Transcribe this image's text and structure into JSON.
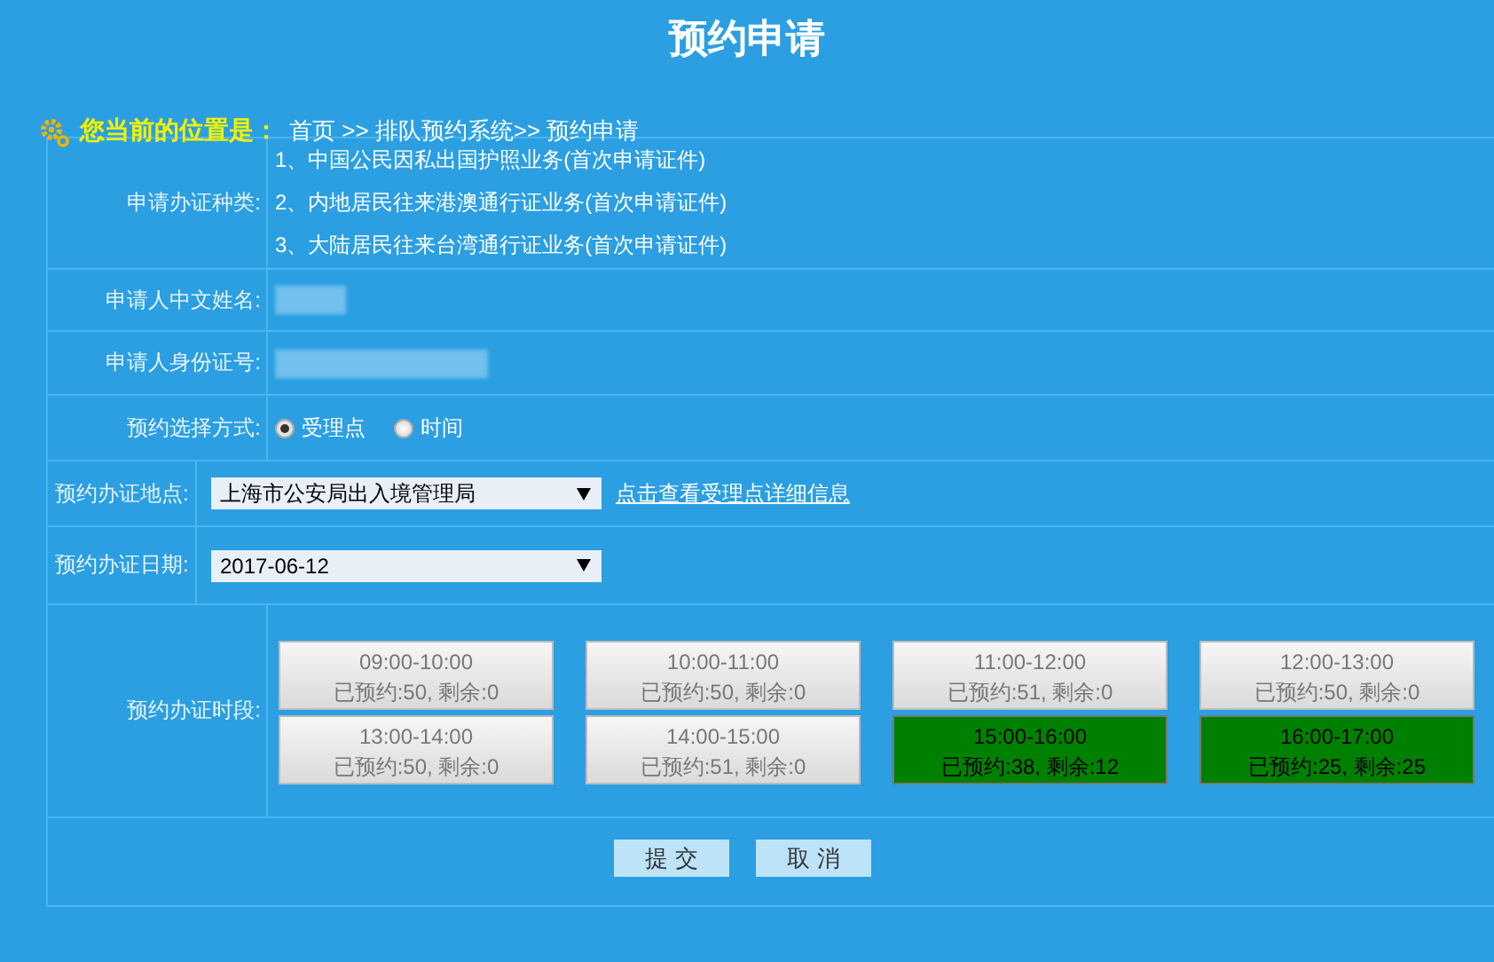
{
  "page_title": "预约申请",
  "breadcrumb": {
    "label": "您当前的位置是：",
    "path": "首页 >> 排队预约系统>> 预约申请"
  },
  "form": {
    "category": {
      "label": "申请办证种类:",
      "items": [
        "1、中国公民因私出国护照业务(首次申请证件)",
        "2、内地居民往来港澳通行证业务(首次申请证件)",
        "3、大陆居民往来台湾通行证业务(首次申请证件)"
      ]
    },
    "name": {
      "label": "申请人中文姓名:"
    },
    "id_number": {
      "label": "申请人身份证号:"
    },
    "mode": {
      "label": "预约选择方式:",
      "options": [
        {
          "label": "受理点",
          "selected": true
        },
        {
          "label": "时间",
          "selected": false
        }
      ]
    },
    "location": {
      "label": "预约办证地点:",
      "value": "上海市公安局出入境管理局",
      "link": "点击查看受理点详细信息"
    },
    "date": {
      "label": "预约办证日期:",
      "value": "2017-06-12"
    },
    "slots": {
      "label": "预约办证时段:",
      "items": [
        {
          "time": "09:00-10:00",
          "booked": "已预约:50, 剩余:0",
          "available": false
        },
        {
          "time": "10:00-11:00",
          "booked": "已预约:50, 剩余:0",
          "available": false
        },
        {
          "time": "11:00-12:00",
          "booked": "已预约:51, 剩余:0",
          "available": false
        },
        {
          "time": "12:00-13:00",
          "booked": "已预约:50, 剩余:0",
          "available": false
        },
        {
          "time": "13:00-14:00",
          "booked": "已预约:50, 剩余:0",
          "available": false
        },
        {
          "time": "14:00-15:00",
          "booked": "已预约:51, 剩余:0",
          "available": false
        },
        {
          "time": "15:00-16:00",
          "booked": "已预约:38, 剩余:12",
          "available": true
        },
        {
          "time": "16:00-17:00",
          "booked": "已预约:25, 剩余:25",
          "available": true
        }
      ]
    }
  },
  "buttons": [
    "提 交",
    "取 消"
  ]
}
